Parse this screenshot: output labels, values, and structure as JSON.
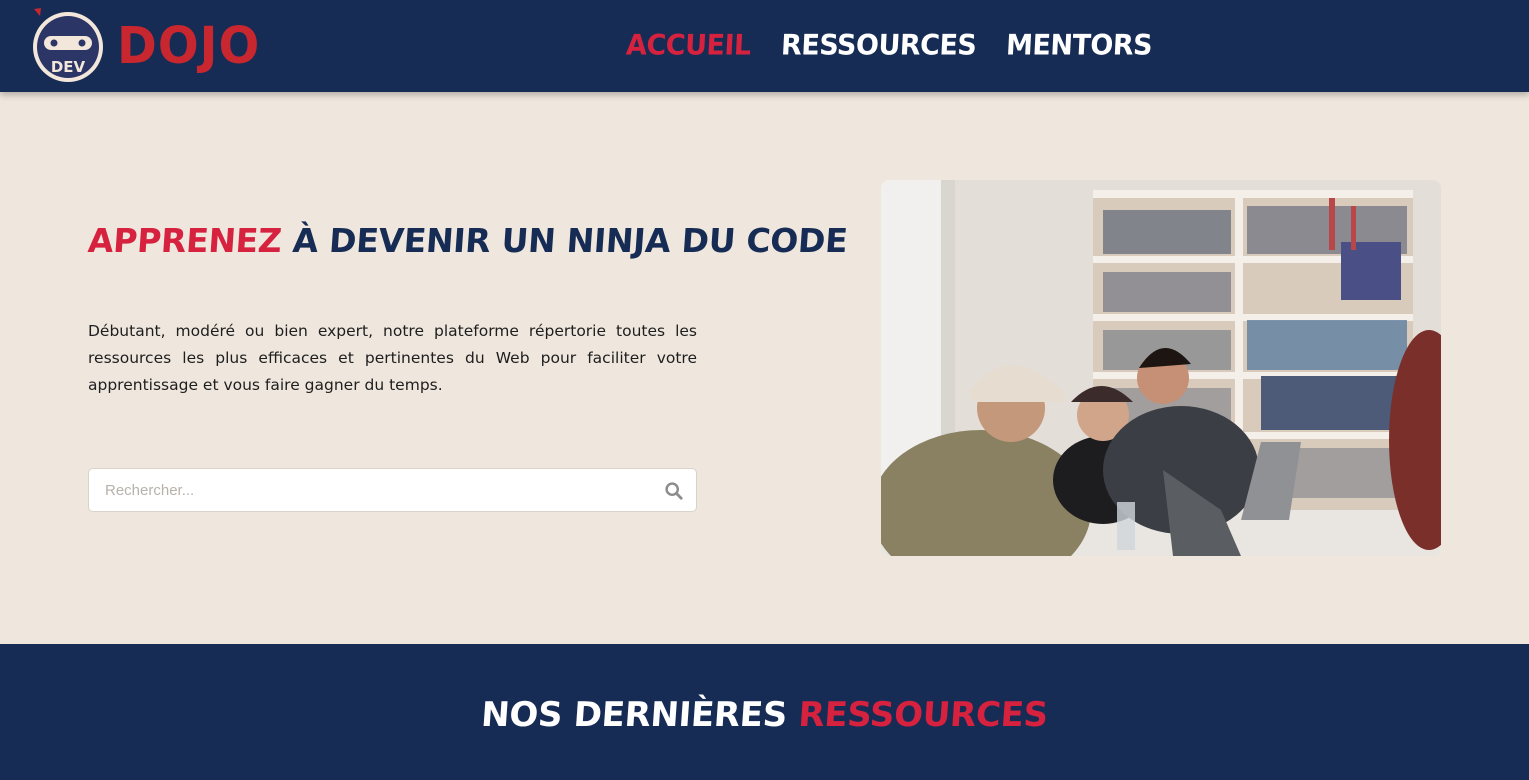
{
  "brand": {
    "name": "DOJO",
    "badge": "DEV"
  },
  "nav": {
    "items": [
      {
        "label": "ACCUEIL",
        "active": true
      },
      {
        "label": "RESSOURCES",
        "active": false
      },
      {
        "label": "MENTORS",
        "active": false
      }
    ]
  },
  "hero": {
    "title_accent": "APPRENEZ",
    "title_rest": " À DEVENIR UN NINJA DU CODE",
    "description": "Débutant, modéré ou bien expert, notre plateforme répertorie toutes les ressources les plus efficaces et pertinentes du Web pour faciliter votre apprentissage et vous faire gagner du temps.",
    "search": {
      "placeholder": "Rechercher...",
      "value": ""
    },
    "image_icon": "photo-students-laughing-library"
  },
  "resources_band": {
    "title_main": "NOS DERNIÈRES ",
    "title_accent": "RESSOURCES"
  },
  "colors": {
    "navy": "#172c54",
    "accent_red": "#d6223f",
    "logo_red": "#c8272f",
    "background": "#efe7de"
  }
}
